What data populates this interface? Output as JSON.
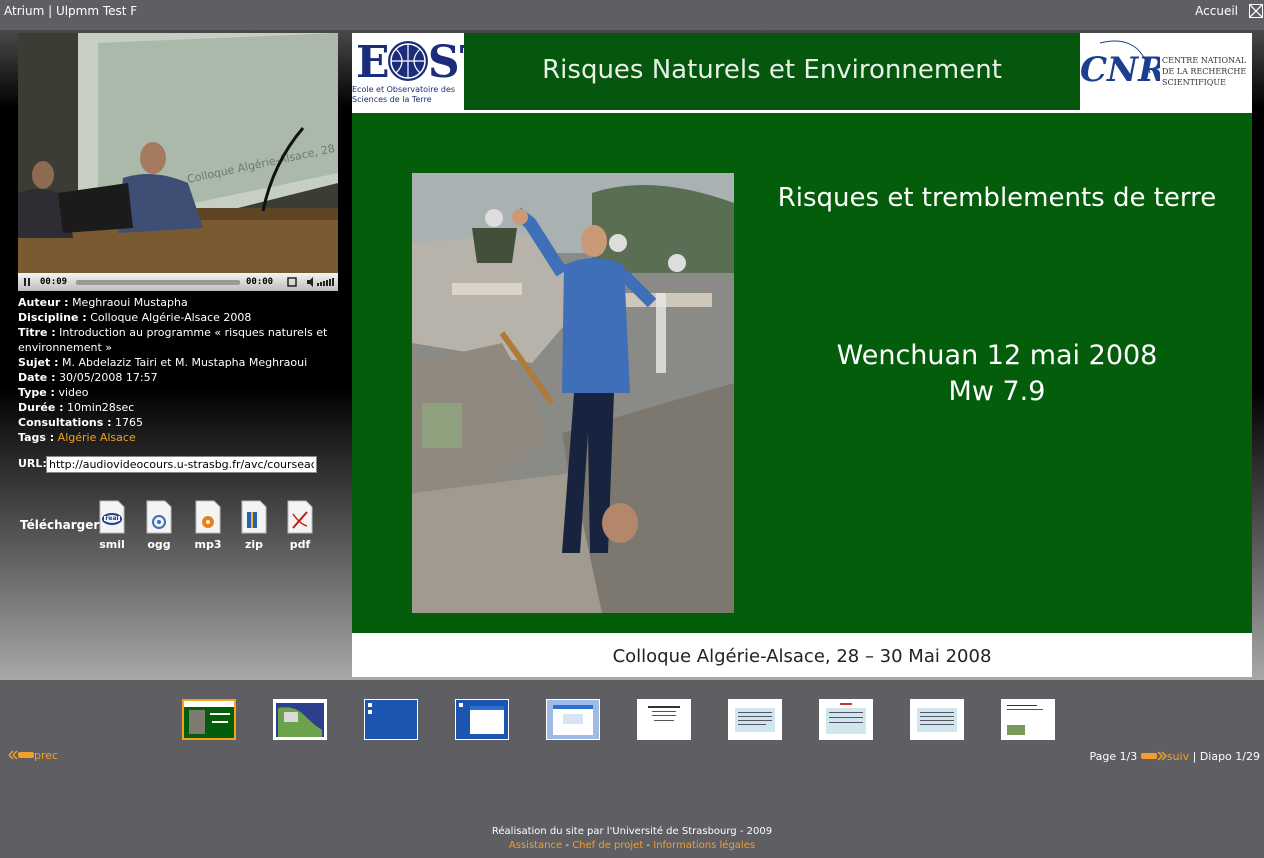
{
  "topbar": {
    "title": "Atrium | Ulpmm Test F",
    "home": "Accueil"
  },
  "player": {
    "elapsed": "00:09",
    "duration": "00:00",
    "progress": 0
  },
  "info": {
    "author_label": "Auteur :",
    "author": "Meghraoui Mustapha",
    "discipline_label": "Discipline :",
    "discipline": "Colloque Algérie-Alsace 2008",
    "title_label": "Titre :",
    "title": "Introduction au programme « risques naturels et environnement »",
    "subject_label": "Sujet :",
    "subject": "M. Abdelaziz Tairi et M. Mustapha Meghraoui",
    "date_label": "Date :",
    "date": "30/05/2008 17:57",
    "type_label": "Type :",
    "type": "video",
    "duration_label": "Durée :",
    "duration": "10min28sec",
    "views_label": "Consultations :",
    "views": "1765",
    "tags_label": "Tags :",
    "tags": "Algérie Alsace"
  },
  "url": {
    "label": "URL:",
    "value": "http://audiovideocours.u-strasbg.fr/avc/courseaccess?id"
  },
  "download": {
    "label": "Télécharger:",
    "items": [
      {
        "name": "smil",
        "icon": "real-icon",
        "color": "#1f3f8f"
      },
      {
        "name": "ogg",
        "icon": "ogg-icon",
        "color": "#3a6fc0"
      },
      {
        "name": "mp3",
        "icon": "mp3-icon",
        "color": "#e8801a"
      },
      {
        "name": "zip",
        "icon": "zip-icon",
        "color": "#2b5fb8"
      },
      {
        "name": "pdf",
        "icon": "pdf-icon",
        "color": "#c41a1a"
      }
    ]
  },
  "slide": {
    "header": "Risques Naturels et Environnement",
    "eost_logo": "EOST",
    "eost_caption": "Ecole et Observatoire des Sciences de la Terre",
    "cnrs_logo": "CNRS",
    "cnrs_caption": "CENTRE NATIONAL DE LA RECHERCHE SCIENTIFIQUE",
    "subtitle": "Risques et tremblements de terre",
    "event_line1": "Wenchuan 12 mai 2008",
    "event_line2": "Mw 7.9",
    "footer": "Colloque Algérie-Alsace, 28 – 30 Mai 2008"
  },
  "thumbnails": [
    {
      "active": true
    },
    {
      "active": false
    },
    {
      "active": false
    },
    {
      "active": false
    },
    {
      "active": false
    },
    {
      "active": false
    },
    {
      "active": false
    },
    {
      "active": false
    },
    {
      "active": false
    },
    {
      "active": false
    }
  ],
  "pager": {
    "prev": "prec",
    "page": "Page 1/3",
    "next": "suiv",
    "separator": "|",
    "diapo": "Diapo 1/29"
  },
  "footer": {
    "credit": "Réalisation du site par l'Université de Strasbourg - 2009",
    "links": [
      "Assistance",
      "Chef de projet",
      "Informations légales"
    ],
    "link_sep": "-"
  },
  "colors": {
    "accent": "#f29f2b",
    "slide_green": "#045d0a"
  }
}
